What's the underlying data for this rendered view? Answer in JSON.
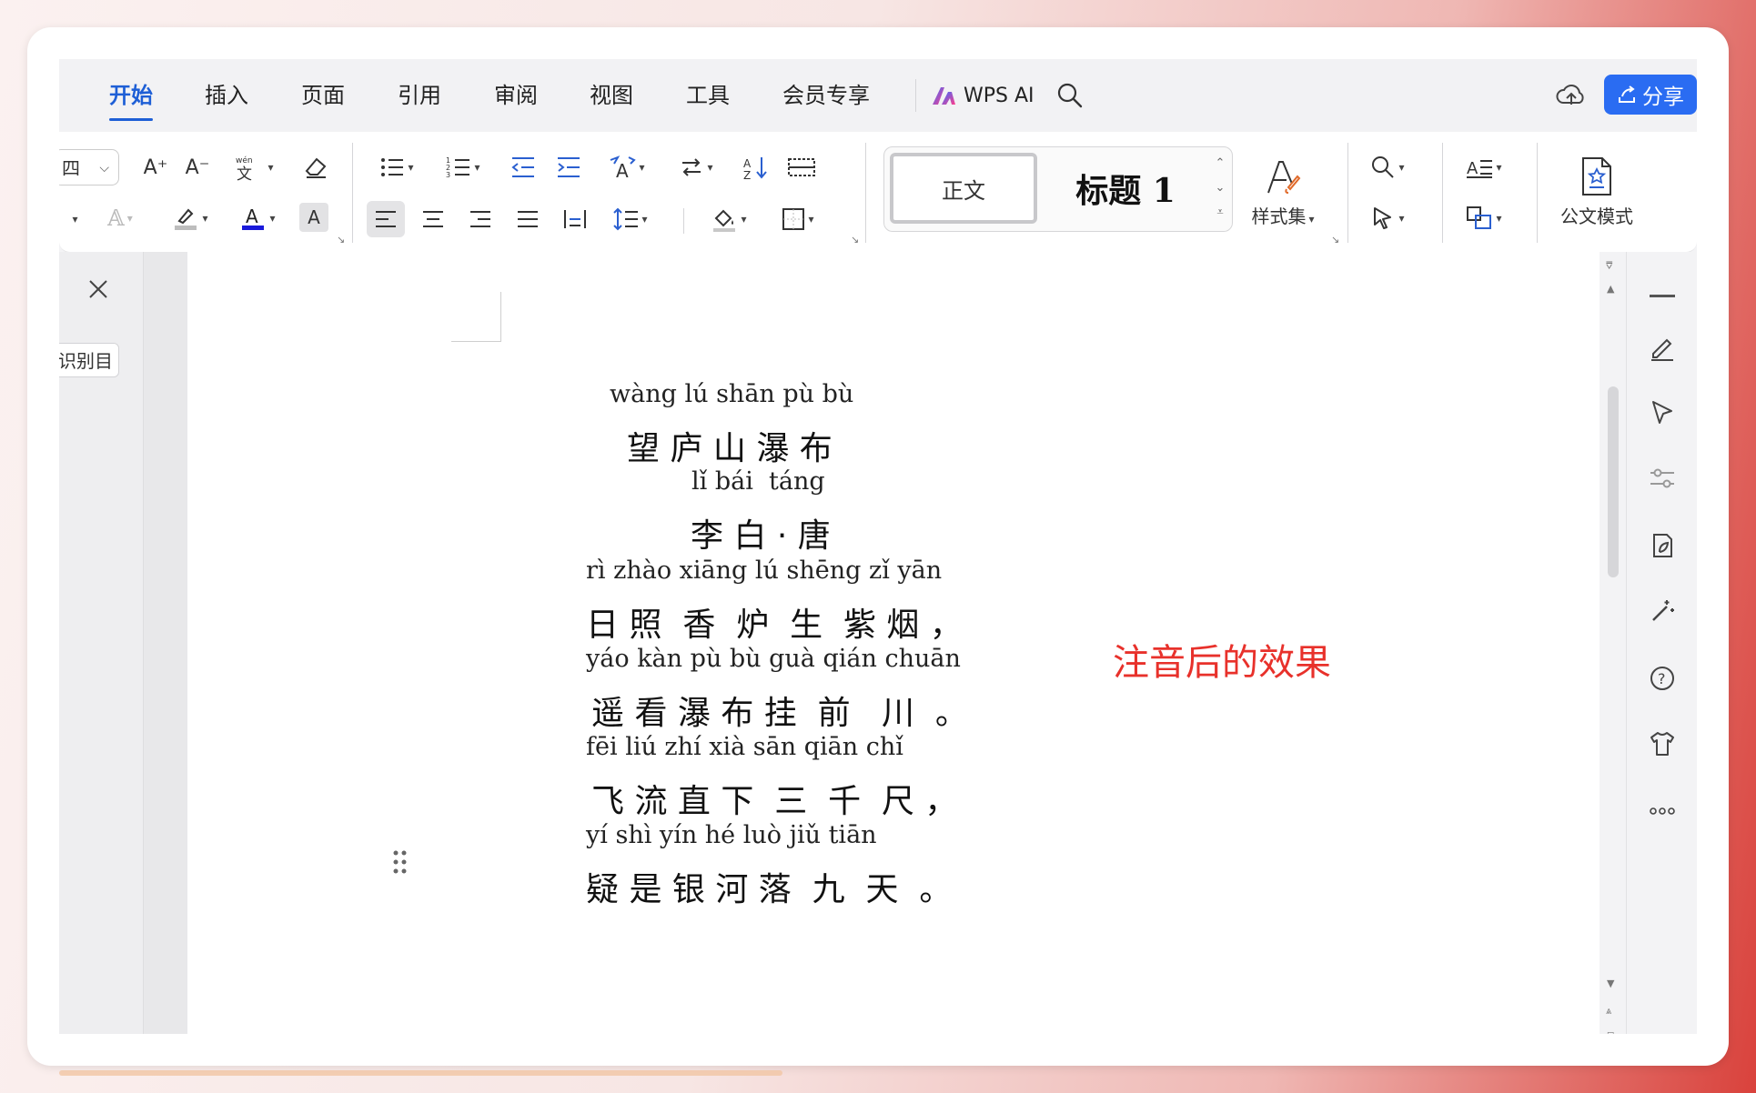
{
  "menu": {
    "tabs": [
      "开始",
      "插入",
      "页面",
      "引用",
      "审阅",
      "视图",
      "工具",
      "会员专享"
    ],
    "ai_label": "WPS AI",
    "share_label": "分享"
  },
  "ribbon": {
    "font_size_value": "四",
    "style_normal": "正文",
    "style_heading": "标题 1",
    "style_set_label": "样式集",
    "official_mode_label": "公文模式",
    "font_grow_label": "A⁺",
    "font_shrink_label": "A⁻"
  },
  "left_panel": {
    "toc_chip": "识别目录"
  },
  "document": {
    "lines": [
      {
        "pinyin": "wàng lú shān pù bù",
        "hanzi": "望 庐 山 瀑 布"
      },
      {
        "pinyin": "lǐ bái  táng",
        "hanzi": "李 白 · 唐"
      },
      {
        "pinyin": "rì zhào xiāng lú shēng zǐ yān",
        "hanzi": "日 照  香  炉  生  紫 烟 ，"
      },
      {
        "pinyin": "yáo kàn pù bù guà qián chuān",
        "hanzi": "遥 看 瀑 布 挂  前   川  。"
      },
      {
        "pinyin": "fēi liú zhí xià sān qiān chǐ",
        "hanzi": "飞 流 直 下  三  千  尺 ，"
      },
      {
        "pinyin": "yí shì yín hé luò jiǔ tiān",
        "hanzi": "疑 是 银 河 落  九  天  。"
      }
    ],
    "annotation": "注音后的效果"
  }
}
